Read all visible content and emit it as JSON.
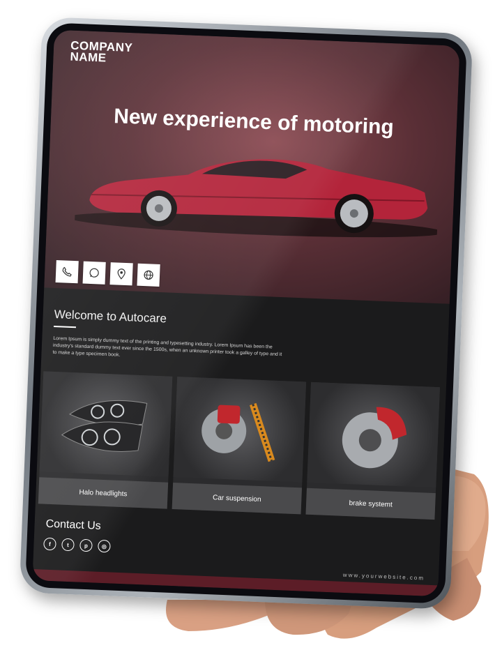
{
  "header": {
    "logo_line1": "COMPANY",
    "logo_line2": "NAME",
    "headline": "New experience of motoring"
  },
  "contact_icons": [
    "phone-icon",
    "whatsapp-icon",
    "location-icon",
    "globe-icon"
  ],
  "welcome": {
    "title": "Welcome to Autocare",
    "body": "Lorem Ipsum is simply dummy text of the printing and typesetting industry. Lorem Ipsum has been the industry's standard dummy text ever since the 1500s, when an unknown printer took a galley of type and it to make a type specimen book."
  },
  "products": [
    {
      "label": "Halo headlights"
    },
    {
      "label": "Car suspension"
    },
    {
      "label": "brake systemt"
    }
  ],
  "contact": {
    "title": "Contact Us",
    "social": [
      {
        "icon": "facebook-icon",
        "glyph": "f"
      },
      {
        "icon": "twitter-icon",
        "glyph": "t"
      },
      {
        "icon": "pinterest-icon",
        "glyph": "p"
      },
      {
        "icon": "instagram-icon",
        "glyph": "◎"
      }
    ]
  },
  "footer": {
    "website": "www.yourwebsite.com"
  },
  "colors": {
    "hero_red": "#8b4a52",
    "car_red": "#b3243a",
    "footer_bar": "#5c1d27",
    "background": "#1b1b1c"
  }
}
